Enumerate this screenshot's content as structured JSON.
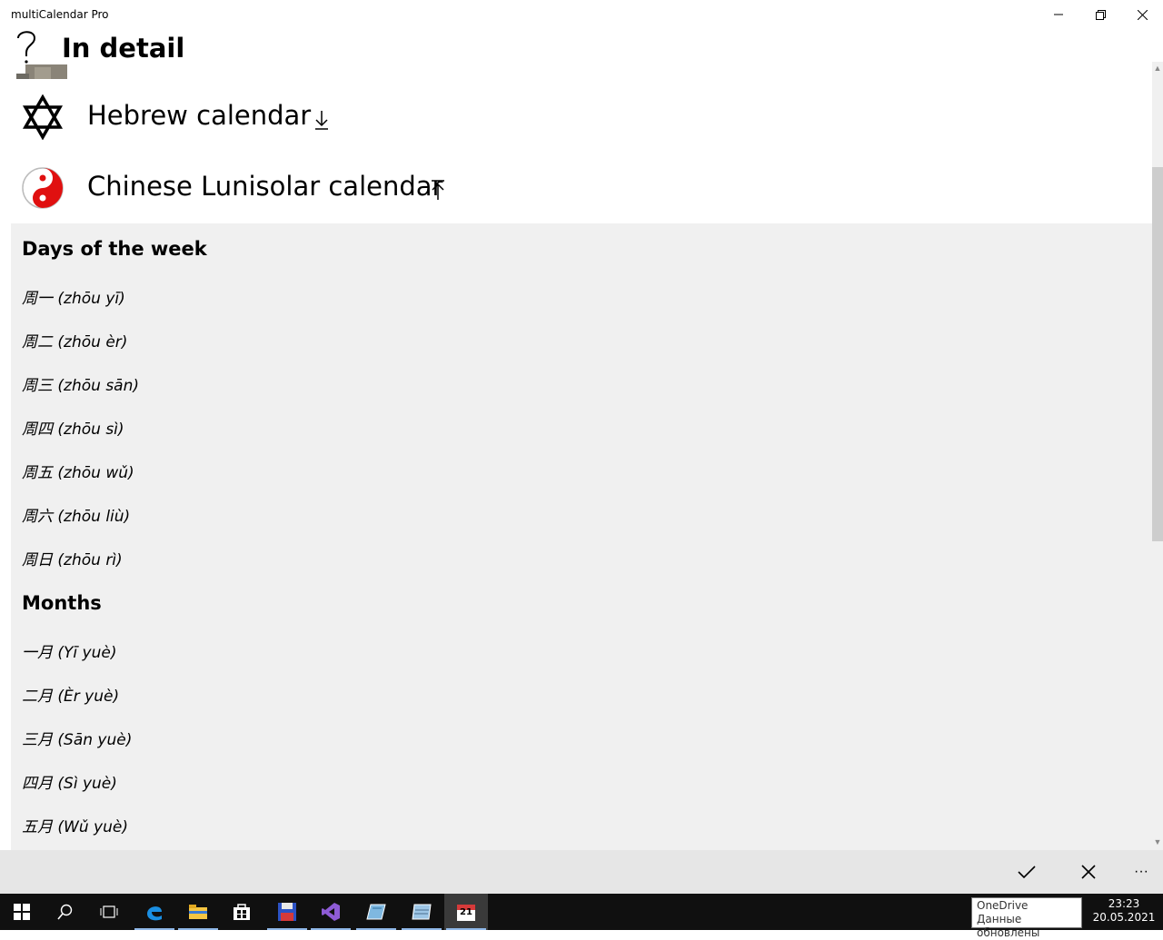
{
  "window": {
    "app_title": "multiCalendar Pro",
    "page_title": "In detail"
  },
  "calendars": [
    {
      "name": "Hebrew calendar",
      "icon": "star-of-david-icon",
      "arrow": "download-arrow-icon"
    },
    {
      "name": "Chinese Lunisolar calendar",
      "icon": "yin-yang-icon",
      "arrow": "collapse-up-arrow-icon"
    }
  ],
  "detail": {
    "days_title": "Days of the week",
    "days": [
      "周一 (zhōu yī)",
      "周二 (zhōu èr)",
      "周三 (zhōu sān)",
      "周四 (zhōu sì)",
      "周五 (zhōu wǔ)",
      "周六 (zhōu liù)",
      "周日 (zhōu rì)"
    ],
    "months_title": "Months",
    "months": [
      "一月 (Yī yuè)",
      "二月 (Èr yuè)",
      "三月 (Sān yuè)",
      "四月 (Sì yuè)",
      "五月 (Wǔ yuè)"
    ]
  },
  "command_bar": {
    "accept_icon": "checkmark-icon",
    "cancel_icon": "close-icon",
    "more_label": "···"
  },
  "taskbar": {
    "time": "23:23",
    "date": "20.05.2021",
    "tooltip_title": "OneDrive",
    "tooltip_text": "Данные обновлены",
    "calendar_day": "21"
  },
  "colors": {
    "detail_bg": "#f0f0f0",
    "command_bar_bg": "#e6e6e6",
    "taskbar_bg": "#101010",
    "yin_yang_red": "#e01010"
  }
}
